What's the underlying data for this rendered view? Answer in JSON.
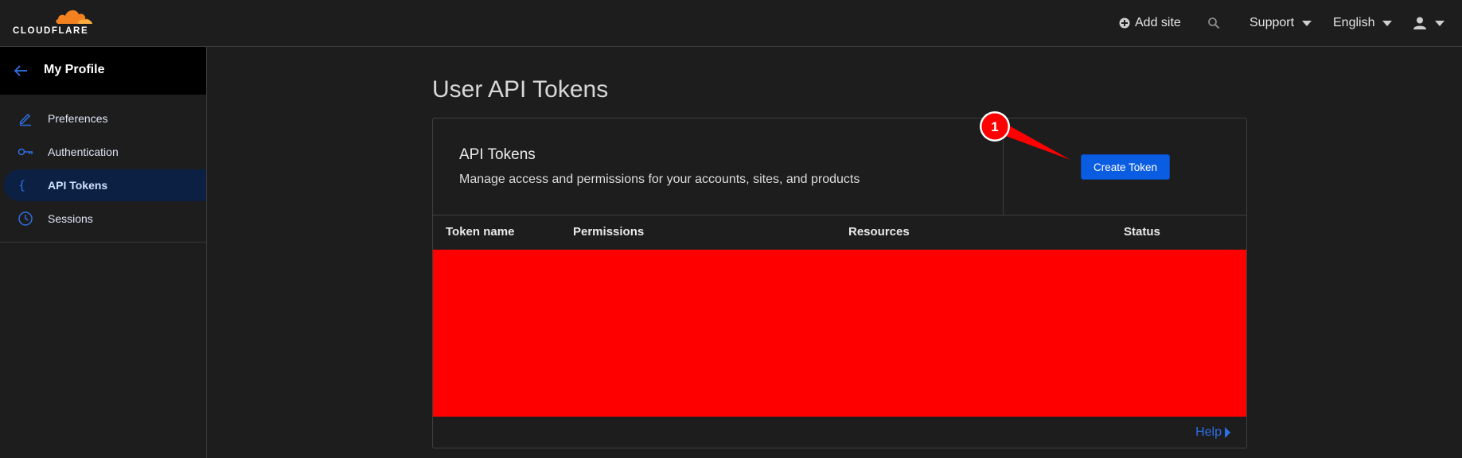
{
  "topbar": {
    "logo_text": "CLOUDFLARE",
    "add_site": "Add site",
    "support": "Support",
    "language": "English"
  },
  "sidebar": {
    "back_title": "My Profile",
    "items": [
      {
        "label": "Preferences",
        "icon": "pencil-icon"
      },
      {
        "label": "Authentication",
        "icon": "key-icon"
      },
      {
        "label": "API Tokens",
        "icon": "braces-icon",
        "active": true
      },
      {
        "label": "Sessions",
        "icon": "clock-icon"
      }
    ]
  },
  "main": {
    "title": "User API Tokens",
    "card": {
      "title": "API Tokens",
      "description": "Manage access and permissions for your accounts, sites, and products",
      "create_button": "Create Token",
      "columns": [
        "Token name",
        "Permissions",
        "Resources",
        "Status"
      ],
      "help_link": "Help"
    }
  },
  "annotation": {
    "step_number": "1",
    "color": "#ff0000"
  },
  "colors": {
    "brand_orange": "#f48120",
    "accent_blue": "#0a5ce0",
    "background": "#1d1d1d"
  }
}
